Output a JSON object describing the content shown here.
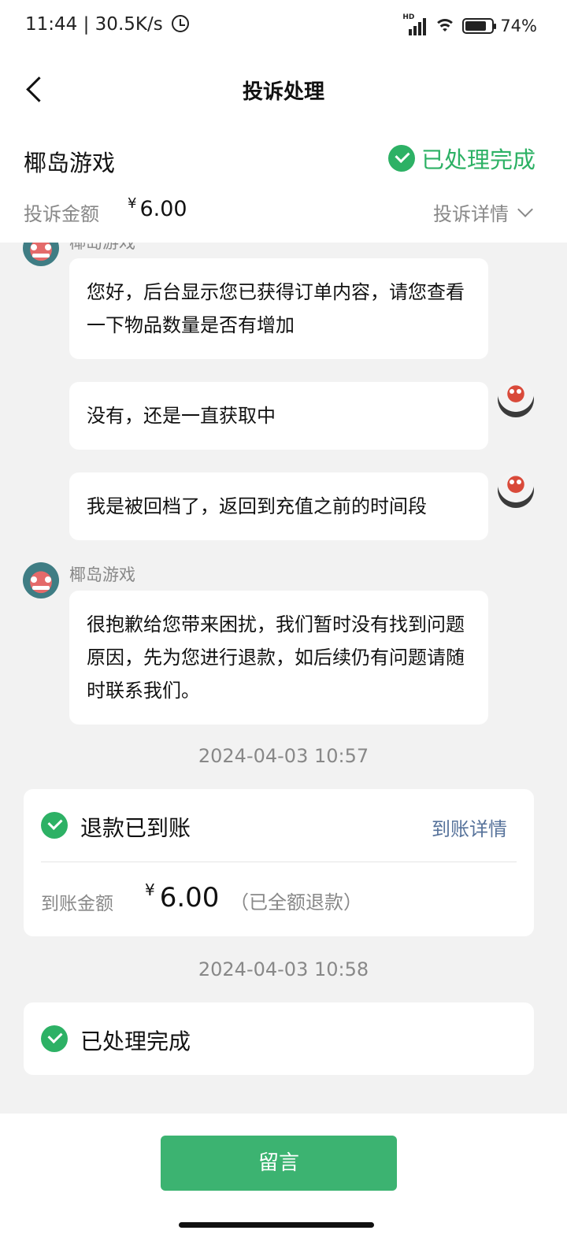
{
  "status_bar": {
    "time": "11:44",
    "net_speed": "30.5K/s",
    "network": "HD",
    "battery": "74%"
  },
  "nav": {
    "title": "投诉处理"
  },
  "summary": {
    "merchant": "椰岛游戏",
    "status": "已处理完成",
    "amount_label": "投诉金额",
    "currency": "¥",
    "amount": "6.00",
    "detail_link": "投诉详情"
  },
  "chat": {
    "merchant_name_partial": "椰岛游戏",
    "msg1": "您好，后台显示您已获得订单内容，请您查看一下物品数量是否有增加",
    "msg2": "没有，还是一直获取中",
    "msg3": "我是被回档了，返回到充值之前的时间段",
    "merchant_name": "椰岛游戏",
    "msg4": "很抱歉给您带来困扰，我们暂时没有找到问题原因，先为您进行退款，如后续仍有问题请随时联系我们。",
    "time1": "2024-04-03 10:57",
    "refund": {
      "title": "退款已到账",
      "link": "到账详情",
      "amount_label": "到账金额",
      "currency": "¥",
      "amount": "6.00",
      "note": "（已全额退款）"
    },
    "time2": "2024-04-03 10:58",
    "done": {
      "title": "已处理完成"
    }
  },
  "bottom": {
    "button": "留言"
  },
  "colors": {
    "accent_green": "#2db165",
    "button_green": "#3cb371",
    "link_blue": "#57739b",
    "page_bg": "#f2f2f2"
  },
  "icons": [
    "alarm-icon",
    "signal-icon",
    "wifi-icon",
    "battery-icon",
    "back-icon",
    "check-circle-icon",
    "chevron-down-icon",
    "avatar"
  ]
}
